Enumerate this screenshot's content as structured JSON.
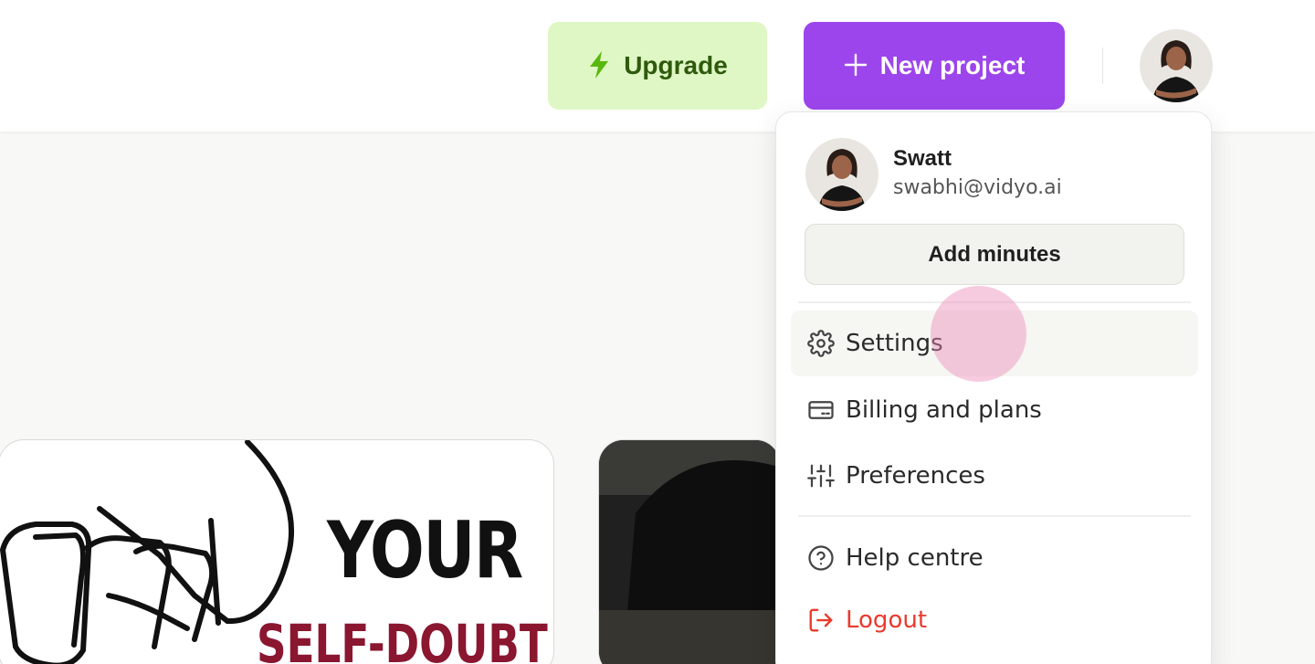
{
  "header": {
    "upgrade_label": "Upgrade",
    "new_project_label": "New project"
  },
  "colors": {
    "brand_purple": "#9d45ec",
    "upgrade_bg": "#dff7c4",
    "upgrade_text": "#2f5a0d",
    "logout_red": "#ea3a2c"
  },
  "user": {
    "name": "Swatt",
    "email": "swabhi@vidyo.ai"
  },
  "menu": {
    "add_minutes_label": "Add minutes",
    "items": [
      {
        "label": "Settings",
        "icon": "gear-icon"
      },
      {
        "label": "Billing and plans",
        "icon": "credit-card-icon"
      },
      {
        "label": "Preferences",
        "icon": "sliders-icon"
      },
      {
        "label": "Help centre",
        "icon": "help-circle-icon"
      },
      {
        "label": "Logout",
        "icon": "logout-icon"
      }
    ]
  },
  "content": {
    "thumbnail_text_line1": "YOUR",
    "thumbnail_text_line2": "SELF-DOUBT"
  }
}
